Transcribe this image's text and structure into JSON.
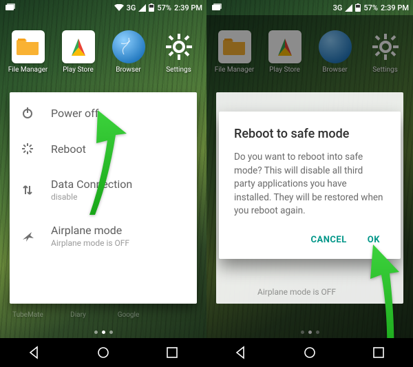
{
  "status": {
    "network": "3G",
    "battery_percent": "57%",
    "time": "2:39 PM"
  },
  "apps": {
    "file_manager": "File Manager",
    "play_store": "Play Store",
    "browser": "Browser",
    "settings": "Settings"
  },
  "lower_apps": {
    "tubemate": "TubeMate",
    "diary": "Diary",
    "google": "Google"
  },
  "power_menu": {
    "power_off": {
      "title": "Power off"
    },
    "reboot": {
      "title": "Reboot"
    },
    "data": {
      "title": "Data Connection",
      "sub": "disable"
    },
    "airplane": {
      "title": "Airplane mode",
      "sub": "Airplane mode is OFF"
    }
  },
  "dialog": {
    "title": "Reboot to safe mode",
    "body": "Do you want to reboot into safe mode? This will disable all third party applications you have installed. They will be restored when you reboot again.",
    "cancel": "CANCEL",
    "ok": "OK"
  }
}
